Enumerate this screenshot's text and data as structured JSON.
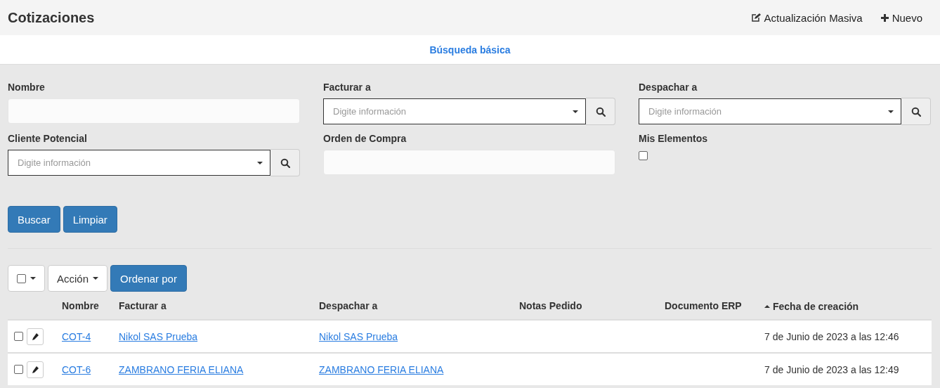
{
  "page": {
    "title": "Cotizaciones",
    "actions": [
      {
        "kind": "edit",
        "label": "Actualización Masiva"
      },
      {
        "kind": "add",
        "label": "Nuevo"
      }
    ]
  },
  "tabs": [
    {
      "label": "Búsqueda básica",
      "selected": true
    }
  ],
  "filters": [
    {
      "kind": "text",
      "label": "Nombre"
    },
    {
      "kind": "select",
      "label": "Facturar a",
      "placeholder": "Digite información"
    },
    {
      "kind": "select",
      "label": "Despachar a",
      "placeholder": "Digite información"
    },
    {
      "kind": "select",
      "label": "Cliente Potencial",
      "placeholder": "Digite información"
    },
    {
      "kind": "text",
      "label": "Orden de Compra"
    },
    {
      "kind": "checkbox",
      "label": "Mis Elementos",
      "checked": false
    }
  ],
  "filter_buttons": [
    "Buscar",
    "Limpiar"
  ],
  "toolbar": {
    "select_all_checked": false,
    "action_label": "Acción",
    "sort_label": "Ordenar por"
  },
  "table": {
    "columns": [
      {
        "label": "Nombre",
        "sorted": false
      },
      {
        "label": "Facturar a",
        "sorted": false
      },
      {
        "label": "Despachar a",
        "sorted": false
      },
      {
        "label": "Notas Pedido",
        "sorted": false
      },
      {
        "label": "Documento ERP",
        "sorted": false
      },
      {
        "label": "Fecha de creación",
        "sorted": true
      }
    ],
    "rows": [
      {
        "checked": false,
        "cells": [
          "COT-4",
          "Nikol SAS Prueba",
          "Nikol SAS Prueba",
          "",
          "",
          "7 de Junio de 2023 a las 12:46"
        ]
      },
      {
        "checked": false,
        "cells": [
          "COT-6",
          "ZAMBRANO FERIA ELIANA",
          "ZAMBRANO FERIA ELIANA",
          "",
          "",
          "7 de Junio de 2023 a las 12:49"
        ]
      }
    ]
  }
}
